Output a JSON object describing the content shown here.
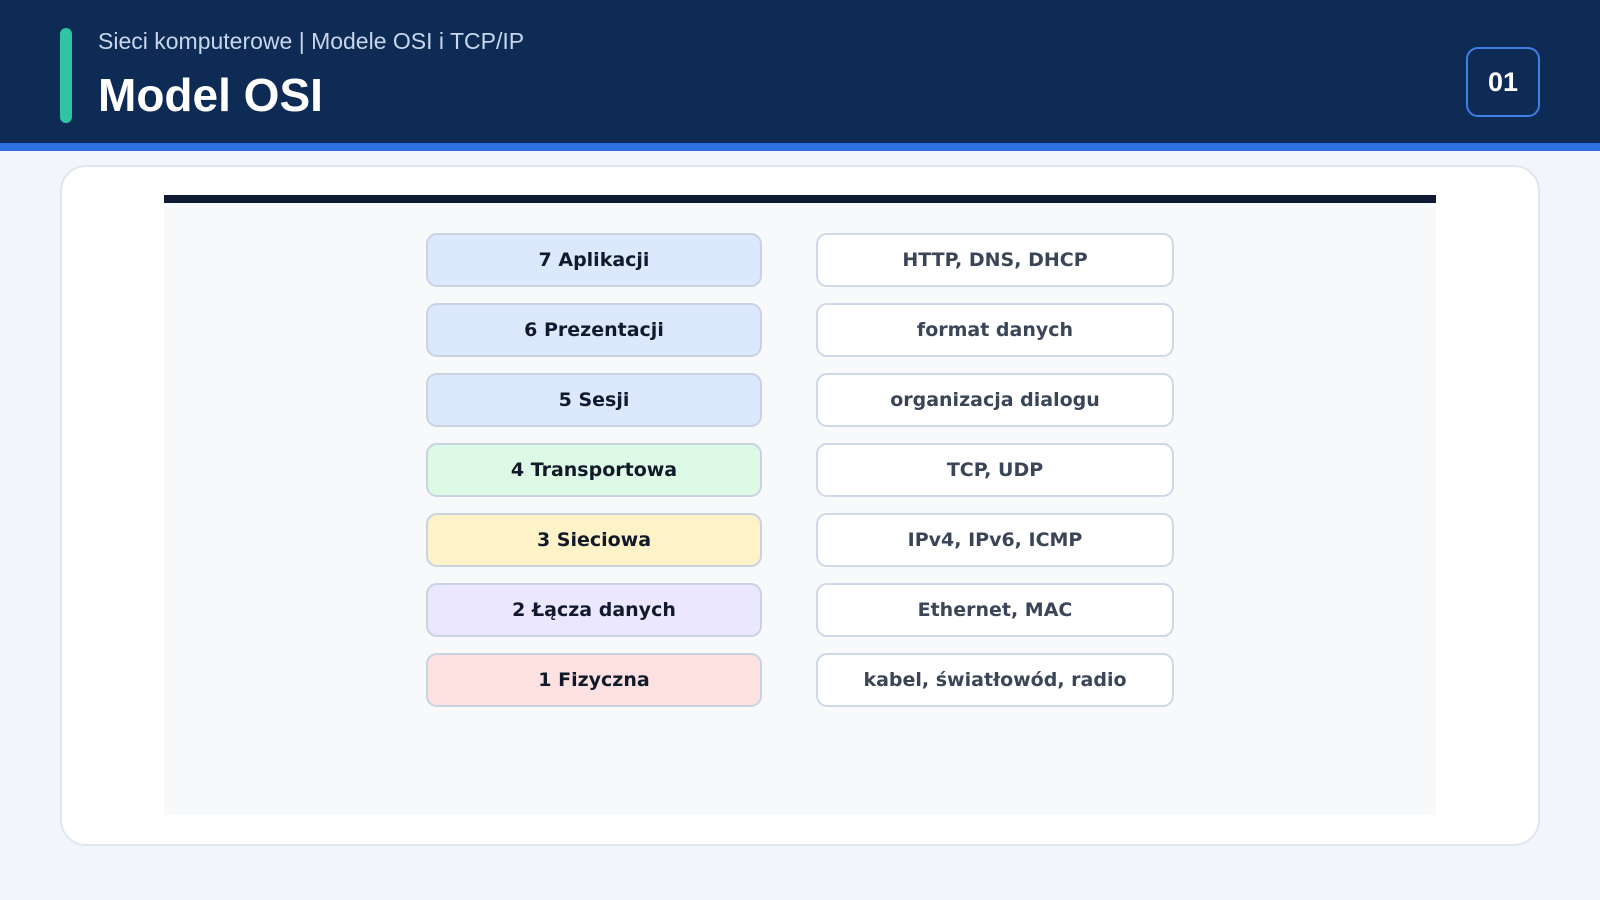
{
  "header": {
    "subtitle": "Sieci komputerowe | Modele OSI i TCP/IP",
    "title": "Model OSI",
    "page_number": "01"
  },
  "colors": {
    "header_bg": "#0d2b55",
    "accent": "#2fc4a2",
    "stripe": "#2f6fe0",
    "upper_layers": "#dbe8fd",
    "transport_layer": "#dcfae6",
    "network_layer": "#fdf2c8",
    "datalink_layer": "#ebe7fd",
    "physical_layer": "#fde1e1"
  },
  "osi": {
    "layers": [
      {
        "label": "7 Aplikacji",
        "protocols": "HTTP, DNS, DHCP",
        "color": "#dbe8fd"
      },
      {
        "label": "6 Prezentacji",
        "protocols": "format danych",
        "color": "#dbe8fd"
      },
      {
        "label": "5 Sesji",
        "protocols": "organizacja dialogu",
        "color": "#dbe8fd"
      },
      {
        "label": "4 Transportowa",
        "protocols": "TCP, UDP",
        "color": "#dcfae6"
      },
      {
        "label": "3 Sieciowa",
        "protocols": "IPv4, IPv6, ICMP",
        "color": "#fdf2c8"
      },
      {
        "label": "2 Łącza danych",
        "protocols": "Ethernet, MAC",
        "color": "#ebe7fd"
      },
      {
        "label": "1 Fizyczna",
        "protocols": "kabel, światłowód, radio",
        "color": "#fde1e1"
      }
    ]
  }
}
